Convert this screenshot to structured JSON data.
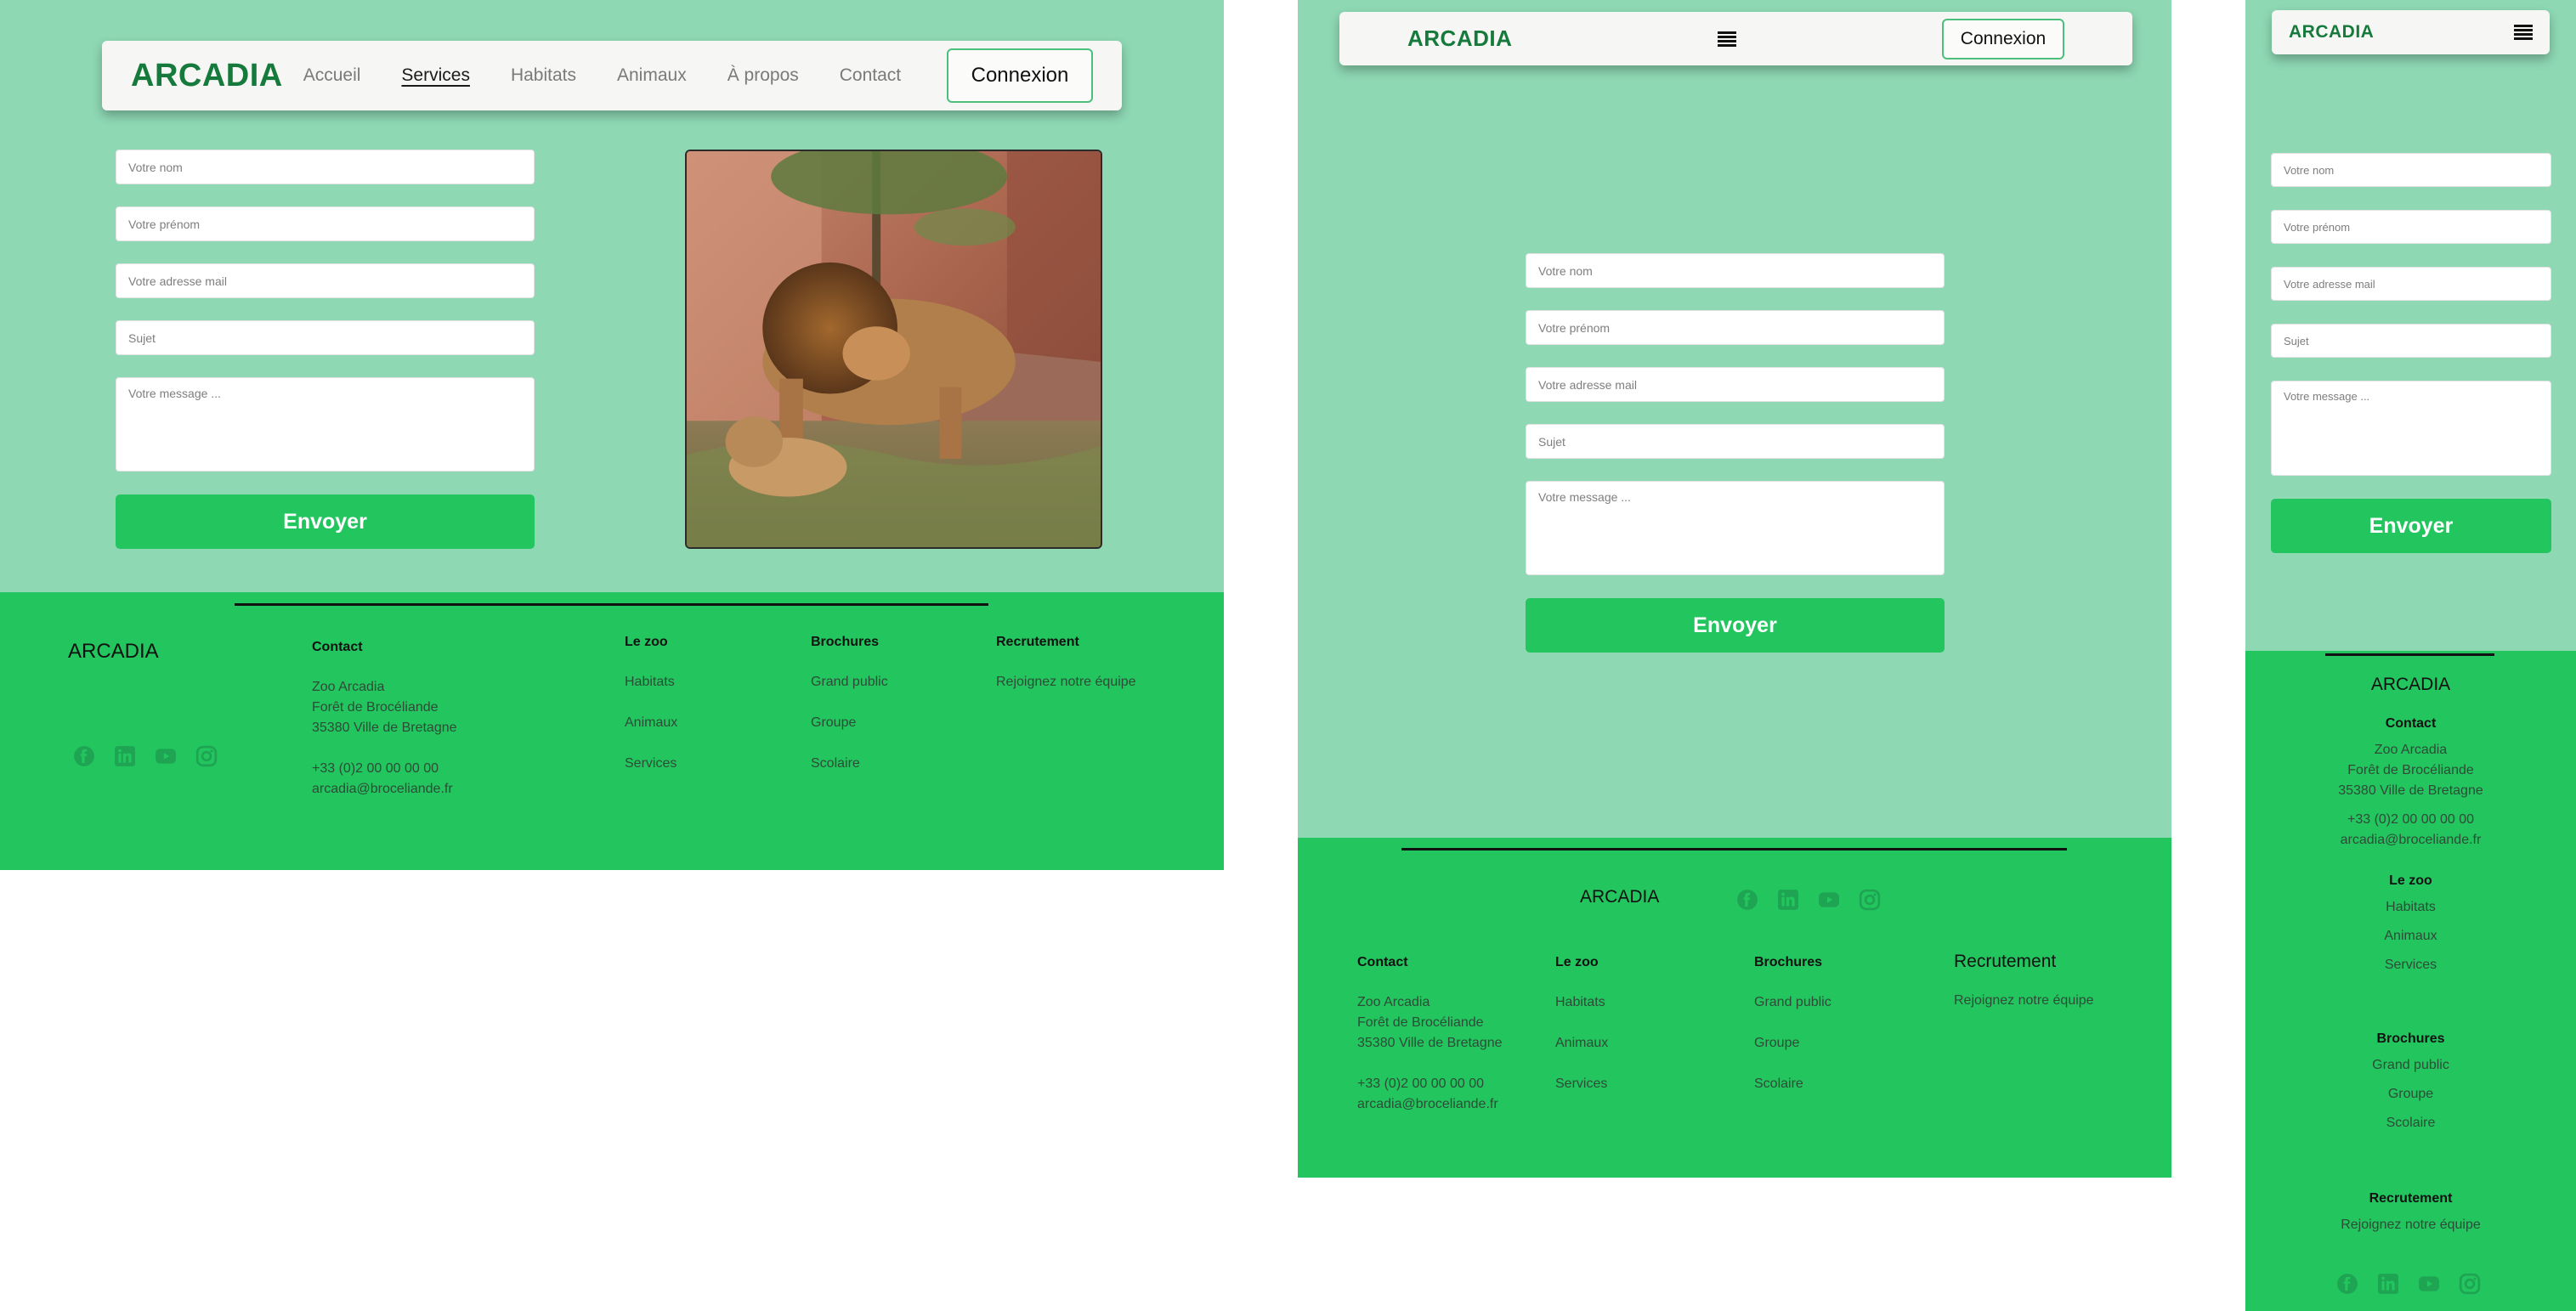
{
  "brand": "ARCADIA",
  "nav": {
    "links": [
      "Accueil",
      "Services",
      "Habitats",
      "Animaux",
      "À propos",
      "Contact"
    ],
    "active": "Services",
    "login": "Connexion"
  },
  "form": {
    "name_placeholder": "Votre nom",
    "firstname_placeholder": "Votre prénom",
    "email_placeholder": "Votre adresse mail",
    "subject_placeholder": "Sujet",
    "message_placeholder": "Votre message ...",
    "submit": "Envoyer"
  },
  "footer": {
    "brand": "ARCADIA",
    "contact": {
      "title": "Contact",
      "address": [
        "Zoo Arcadia",
        "Forêt de Brocéliande",
        "35380 Ville de Bretagne"
      ],
      "phone": "+33 (0)2 00 00 00 00",
      "email": "arcadia@broceliande.fr"
    },
    "zoo": {
      "title": "Le zoo",
      "links": [
        "Habitats",
        "Animaux",
        "Services"
      ]
    },
    "brochures": {
      "title": "Brochures",
      "links": [
        "Grand public",
        "Groupe",
        "Scolaire"
      ]
    },
    "recruitment": {
      "title": "Recrutement",
      "links": [
        "Rejoignez notre équipe"
      ]
    },
    "social_icons": [
      "facebook-icon",
      "linkedin-icon",
      "youtube-icon",
      "instagram-icon"
    ]
  },
  "colors": {
    "background": "#8ed8b4",
    "footer": "#22c55e",
    "brand": "#157a3b",
    "button": "#22c55e",
    "login_border": "#4cbf7c"
  }
}
